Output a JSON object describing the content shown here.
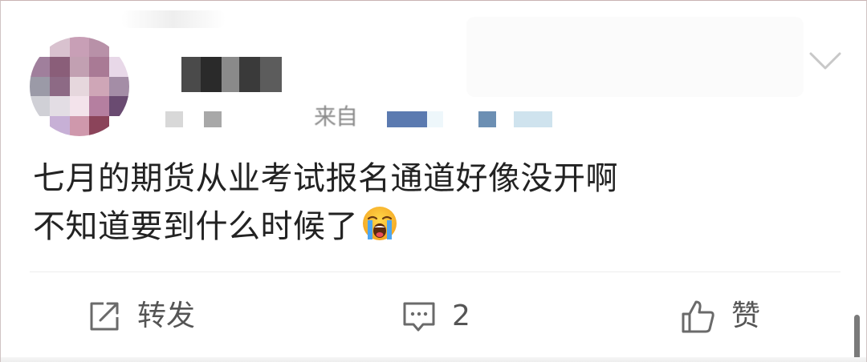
{
  "post": {
    "source_prefix": "来自",
    "text_line1": "七月的期货从业考试报名通道好像没开啊",
    "text_line2": "不知道要到什么时候了",
    "emoji_icon": "loudly-crying-face-icon"
  },
  "actions": {
    "repost_label": "转发",
    "comment_count": "2",
    "like_label": "赞"
  },
  "colors": {
    "text": "#222222",
    "action_text": "#555555",
    "meta_gray": "#8a8a8a",
    "divider": "#ececec"
  }
}
